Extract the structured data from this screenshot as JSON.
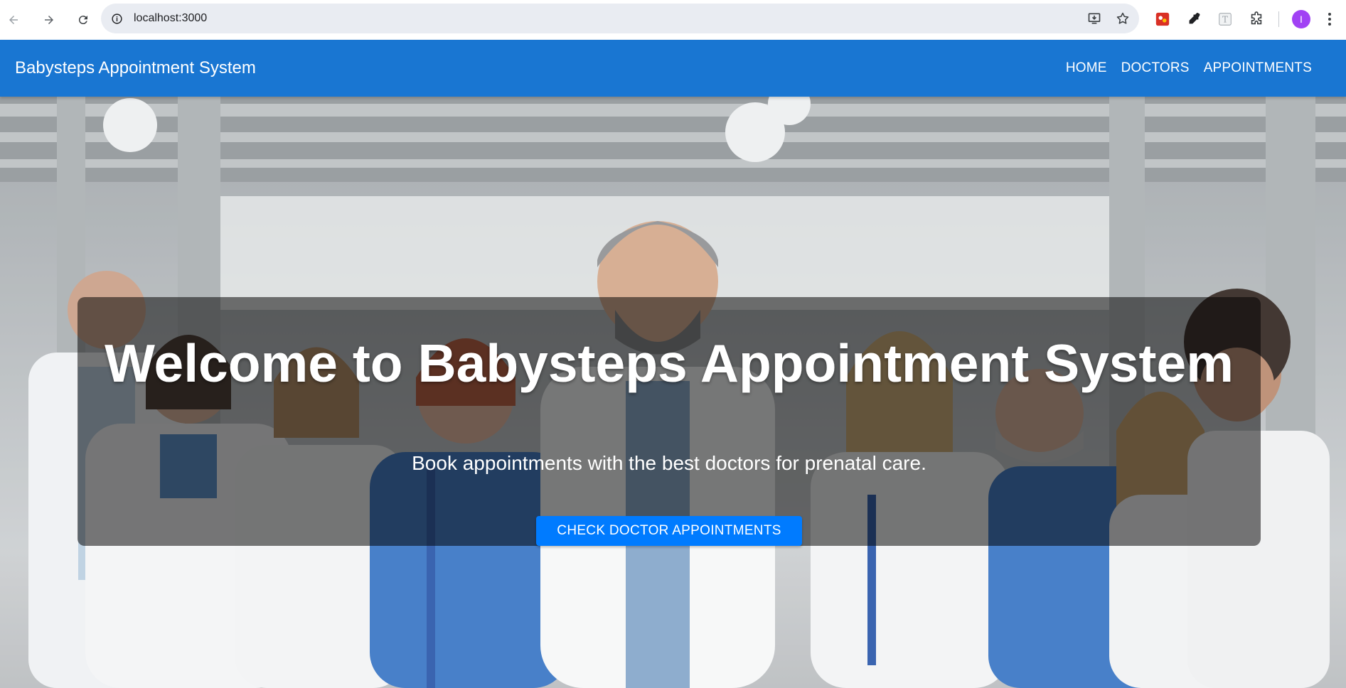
{
  "browser": {
    "url": "localhost:3000",
    "profile_initial": "I",
    "icons": {
      "back": "back-arrow-icon",
      "forward": "forward-arrow-icon",
      "reload": "reload-icon",
      "site_info": "info-icon",
      "install": "install-app-icon",
      "bookmark": "star-icon",
      "extensions": "puzzle-icon",
      "menu": "kebab-menu-icon"
    },
    "colors": {
      "omnibox": "#e9ecf2",
      "avatar": "#a142f4"
    }
  },
  "navbar": {
    "brand": "Babysteps Appointment System",
    "links": [
      {
        "label": "HOME"
      },
      {
        "label": "DOCTORS"
      },
      {
        "label": "APPOINTMENTS"
      }
    ],
    "color": "#1976d2"
  },
  "hero": {
    "title": "Welcome to Babysteps Appointment System",
    "subtitle": "Book appointments with the best doctors for prenatal care.",
    "cta_label": "CHECK DOCTOR APPOINTMENTS",
    "cta_color": "#007bff",
    "background": "photo of a group of smiling medical staff in white coats and blue scrubs in a bright hospital corridor"
  }
}
